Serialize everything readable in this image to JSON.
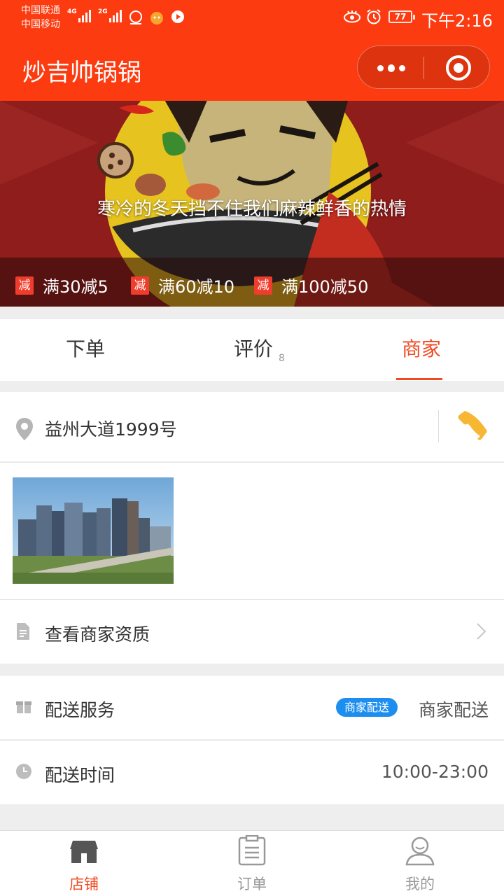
{
  "status_bar": {
    "carrier_1": "中国联通",
    "carrier_2": "中国移动",
    "network_1": "4G",
    "network_2": "2G",
    "battery": "77",
    "time": "下午2:16"
  },
  "navbar": {
    "title": "炒吉帅锅锅"
  },
  "banner": {
    "slogan": "寒冷的冬天挡不住我们麻辣鲜香的热情",
    "discount_tag": "减",
    "discounts": [
      "满30减5",
      "满60减10",
      "满100减50"
    ]
  },
  "tabs": {
    "order": "下单",
    "reviews": "评价",
    "review_count": "8",
    "merchant": "商家"
  },
  "merchant": {
    "address": "益州大道1999号",
    "qualification": "查看商家资质",
    "delivery_service_label": "配送服务",
    "delivery_badge": "商家配送",
    "delivery_value": "商家配送",
    "delivery_time_label": "配送时间",
    "delivery_time_value": "10:00-23:00"
  },
  "tabbar": {
    "shop": "店铺",
    "orders": "订单",
    "mine": "我的"
  },
  "colors": {
    "brand": "#fc3b10",
    "accent": "#f04a23",
    "badge": "#1c8ef0",
    "phone_icon": "#f7b733"
  }
}
